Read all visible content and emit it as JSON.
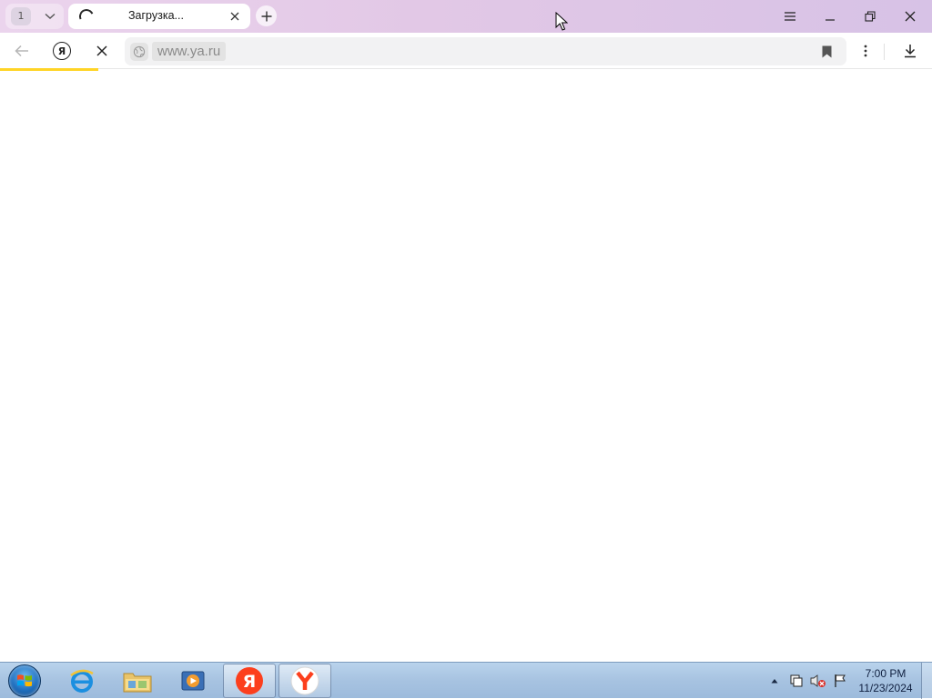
{
  "browser": {
    "tab_count": "1",
    "tab": {
      "title": "Загрузка..."
    },
    "address": {
      "url": "www.ya.ru"
    },
    "loading_progress_fraction": 0.105
  },
  "taskbar": {
    "apps": [
      {
        "name": "internet-explorer",
        "icon": "ie-icon"
      },
      {
        "name": "file-explorer",
        "icon": "folder-icon"
      },
      {
        "name": "media-player",
        "icon": "media-player-icon"
      },
      {
        "name": "yandex",
        "icon": "yandex-icon"
      },
      {
        "name": "yandex-browser",
        "icon": "yandex-browser-icon"
      }
    ],
    "clock": {
      "time": "7:00 PM",
      "date": "11/23/2024"
    }
  },
  "colors": {
    "titlebar_accent": "#e2c8e6",
    "progress": "#ffd426",
    "yandex_red": "#fc3f1d",
    "taskbar": "#a7c3e1"
  }
}
